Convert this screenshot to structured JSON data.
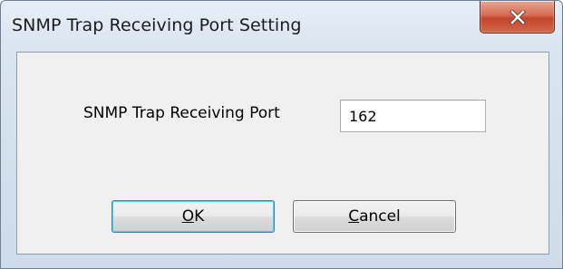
{
  "window": {
    "title": "SNMP Trap Receiving Port Setting",
    "close_icon": "close-icon"
  },
  "form": {
    "port_label": "SNMP Trap Receiving Port",
    "port_value": "162"
  },
  "buttons": {
    "ok_mnemonic": "O",
    "ok_rest": "K",
    "cancel_mnemonic": "C",
    "cancel_rest": "ancel"
  },
  "colors": {
    "close_button": "#c7462d",
    "default_button_border": "#3c7fb1"
  }
}
